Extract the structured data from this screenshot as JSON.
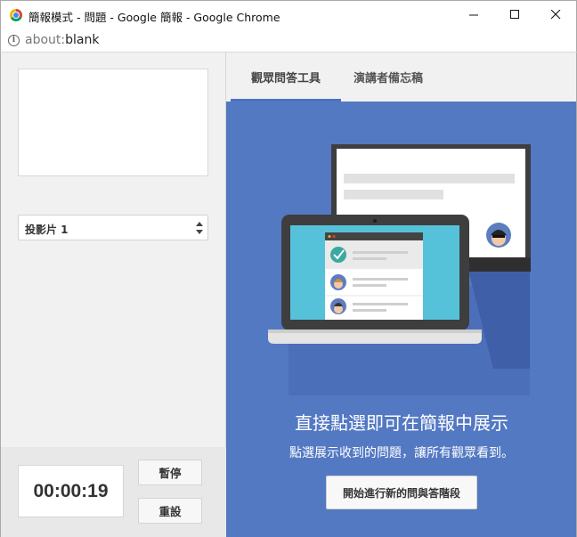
{
  "window": {
    "title": "簡報模式 - 問題 - Google 簡報 - Google Chrome",
    "url_scheme": "about:",
    "url_rest": "blank"
  },
  "left_panel": {
    "slide_selector": {
      "selected": "投影片 1"
    },
    "timer": {
      "value": "00:00:19"
    },
    "pause_label": "暫停",
    "reset_label": "重設"
  },
  "tabs": [
    {
      "label": "觀眾問答工具",
      "active": true
    },
    {
      "label": "演講者備忘稿",
      "active": false
    }
  ],
  "main": {
    "headline": "直接點選即可在簡報中展示",
    "subline": "點選展示收到的問題，讓所有觀眾看到。",
    "start_button": "開始進行新的問與答階段"
  },
  "colors": {
    "accent_blue": "#5479c3",
    "tab_underline": "#4d73bf",
    "laptop_screen": "#56c2d9",
    "check_green": "#3aa99f"
  },
  "icons": {
    "app": "chrome-icon",
    "info": "info-icon",
    "select_arrows": "up-down-arrows-icon",
    "check": "check-icon"
  }
}
